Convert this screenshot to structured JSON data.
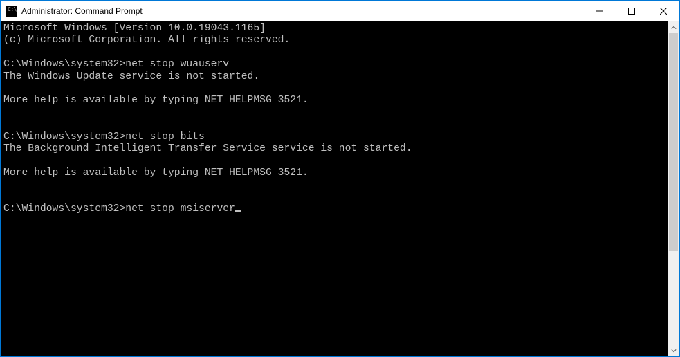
{
  "window": {
    "title": "Administrator: Command Prompt"
  },
  "terminal": {
    "banner_line1": "Microsoft Windows [Version 10.0.19043.1165]",
    "banner_line2": "(c) Microsoft Corporation. All rights reserved.",
    "prompt": "C:\\Windows\\system32>",
    "block1": {
      "cmd": "net stop wuauserv",
      "out1": "The Windows Update service is not started.",
      "out2": "More help is available by typing NET HELPMSG 3521."
    },
    "block2": {
      "cmd": "net stop bits",
      "out1": "The Background Intelligent Transfer Service service is not started.",
      "out2": "More help is available by typing NET HELPMSG 3521."
    },
    "block3": {
      "cmd": "net stop msiserver"
    }
  }
}
